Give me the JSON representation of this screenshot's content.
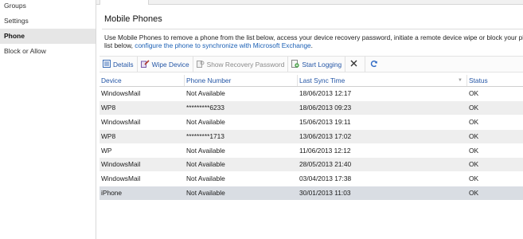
{
  "nav": {
    "items": [
      {
        "label": "Groups"
      },
      {
        "label": "Settings"
      },
      {
        "label": "Phone"
      },
      {
        "label": "Block or Allow"
      }
    ]
  },
  "panel": {
    "title": "Mobile Phones",
    "description_line1": "Use Mobile Phones to remove a phone from the list below, access your device recovery password, initiate a remote device wipe or block your pho",
    "description_line2_prefix": "list below,",
    "description_link": "configure the phone to synchronize with Microsoft Exchange",
    "description_suffix": "."
  },
  "toolbar": {
    "details_label": "Details",
    "wipe_label": "Wipe Device",
    "recovery_label": "Show Recovery Password",
    "logging_label": "Start Logging"
  },
  "table": {
    "headers": [
      "Device",
      "Phone Number",
      "Last Sync Time",
      "Status"
    ],
    "rows": [
      {
        "device": "WindowsMail",
        "phone": "Not Available",
        "sync": "18/06/2013 12:17",
        "status": "OK"
      },
      {
        "device": "WP8",
        "phone": "*********6233",
        "sync": "18/06/2013 09:23",
        "status": "OK"
      },
      {
        "device": "WindowsMail",
        "phone": "Not Available",
        "sync": "15/06/2013 19:11",
        "status": "OK"
      },
      {
        "device": "WP8",
        "phone": "*********1713",
        "sync": "13/06/2013 17:02",
        "status": "OK"
      },
      {
        "device": "WP",
        "phone": "Not Available",
        "sync": "11/06/2013 12:12",
        "status": "OK"
      },
      {
        "device": "WindowsMail",
        "phone": "Not Available",
        "sync": "28/05/2013 21:40",
        "status": "OK"
      },
      {
        "device": "WindowsMail",
        "phone": "Not Available",
        "sync": "03/04/2013 17:38",
        "status": "OK"
      },
      {
        "device": "iPhone",
        "phone": "Not Available",
        "sync": "30/01/2013 11:03",
        "status": "OK"
      }
    ]
  },
  "colors": {
    "link": "#1a5fb4",
    "selected_row": "#d9dde3",
    "alt_row": "#eeeeee"
  },
  "icons": {
    "details": "details-icon",
    "wipe": "wipe-icon",
    "recovery": "recovery-password-icon",
    "logging": "start-logging-icon",
    "delete": "delete-icon",
    "refresh": "refresh-icon"
  }
}
